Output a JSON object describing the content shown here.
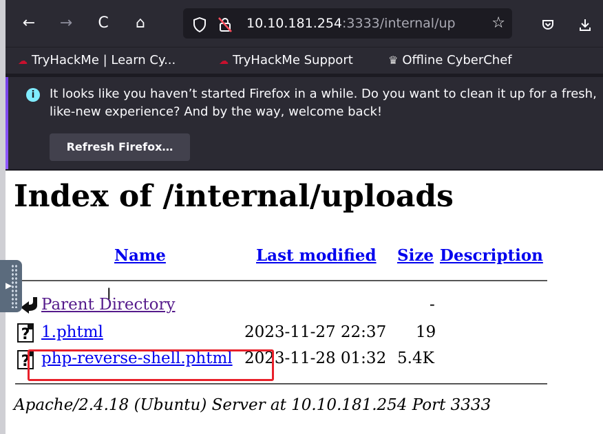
{
  "browser": {
    "nav": {
      "back": "←",
      "forward": "→",
      "reload": "C",
      "home": "⌂"
    },
    "url": {
      "host": "10.10.181.254",
      "rest": ":3333/internal/up"
    },
    "bookmarks": [
      {
        "label": "TryHackMe | Learn Cy..."
      },
      {
        "label": "TryHackMe Support"
      },
      {
        "label": "Offline CyberChef"
      }
    ],
    "notification": {
      "message": "It looks like you haven’t started Firefox in a while. Do you want to clean it up for a fresh, like-new experience? And by the way, welcome back!",
      "button": "Refresh Firefox…"
    }
  },
  "page": {
    "title": "Index of /internal/uploads",
    "columns": {
      "name": "Name",
      "last_modified": "Last modified",
      "size": "Size",
      "description": "Description"
    },
    "rows": [
      {
        "name": "Parent Directory",
        "modified": "",
        "size": "-"
      },
      {
        "name": "1.phtml",
        "modified": "2023-11-27 22:37",
        "size": "19"
      },
      {
        "name": "php-reverse-shell.phtml",
        "modified": "2023-11-28 01:32",
        "size": "5.4K"
      }
    ],
    "footer": "Apache/2.4.18 (Ubuntu) Server at 10.10.181.254 Port 3333"
  }
}
